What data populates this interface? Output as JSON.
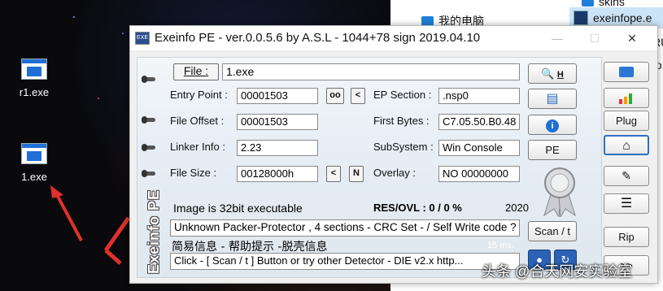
{
  "desktop": {
    "icons": [
      {
        "label": "r1.exe"
      },
      {
        "label": "1.exe"
      }
    ]
  },
  "explorer": {
    "items": [
      {
        "label": "skins",
        "type": "folder"
      },
      {
        "label": "我的电脑",
        "type": "folder"
      },
      {
        "label": "exeinfope.e",
        "type": "exe"
      },
      {
        "label": "RU",
        "type": "file"
      },
      {
        "label": "to",
        "type": "file"
      }
    ]
  },
  "window": {
    "title": "Exeinfo PE - ver.0.0.5.6  by A.S.L -  1044+78 sign  2019.04.10",
    "minimize": "—",
    "maximize": "☐",
    "close": "✕",
    "file_button": "File :",
    "file_value": "1.exe",
    "entry_point_label": "Entry Point :",
    "entry_point_value": "00001503",
    "ep_btn_oo": "oo",
    "ep_btn_lt": "<",
    "ep_section_label": "EP Section :",
    "ep_section_value": ".nsp0",
    "file_offset_label": "File Offset :",
    "file_offset_value": "00001503",
    "first_bytes_label": "First Bytes :",
    "first_bytes_value": "C7.05.50.B0.48",
    "linker_label": "Linker Info :",
    "linker_value": "2.23",
    "subsystem_label": "SubSystem :",
    "subsystem_value": "Win Console",
    "file_size_label": "File Size :",
    "file_size_value": "00128000h",
    "fs_btn_lt": "<",
    "fs_btn_n": "N",
    "overlay_label": "Overlay :",
    "overlay_value": "NO  00000000",
    "image_info": "Image is 32bit executable",
    "res_ovl": "RES/OVL : 0 / 0 %",
    "year": "2020",
    "detect_result": "Unknown Packer-Protector , 4 sections - CRC Set -  / Self Write code ?",
    "hint_line": "简易信息 - 帮助提示 -脱壳信息",
    "ms": "15 ms.",
    "bottom_line": "Click - [ Scan / t ]  Button  or  try other Detector - DIE v2.x  http...",
    "banner": "Exeinfo PE",
    "btn_h": "H",
    "btn_pe": "PE",
    "btn_scan": "Scan / t",
    "btn_plug": "Plug",
    "btn_rip": "Rip",
    "btn_more": ">>"
  },
  "watermark": "头条 @合天网安实验室",
  "colors": {
    "accent_blue": "#2d6fc2",
    "arrow_red": "#e0312b"
  }
}
